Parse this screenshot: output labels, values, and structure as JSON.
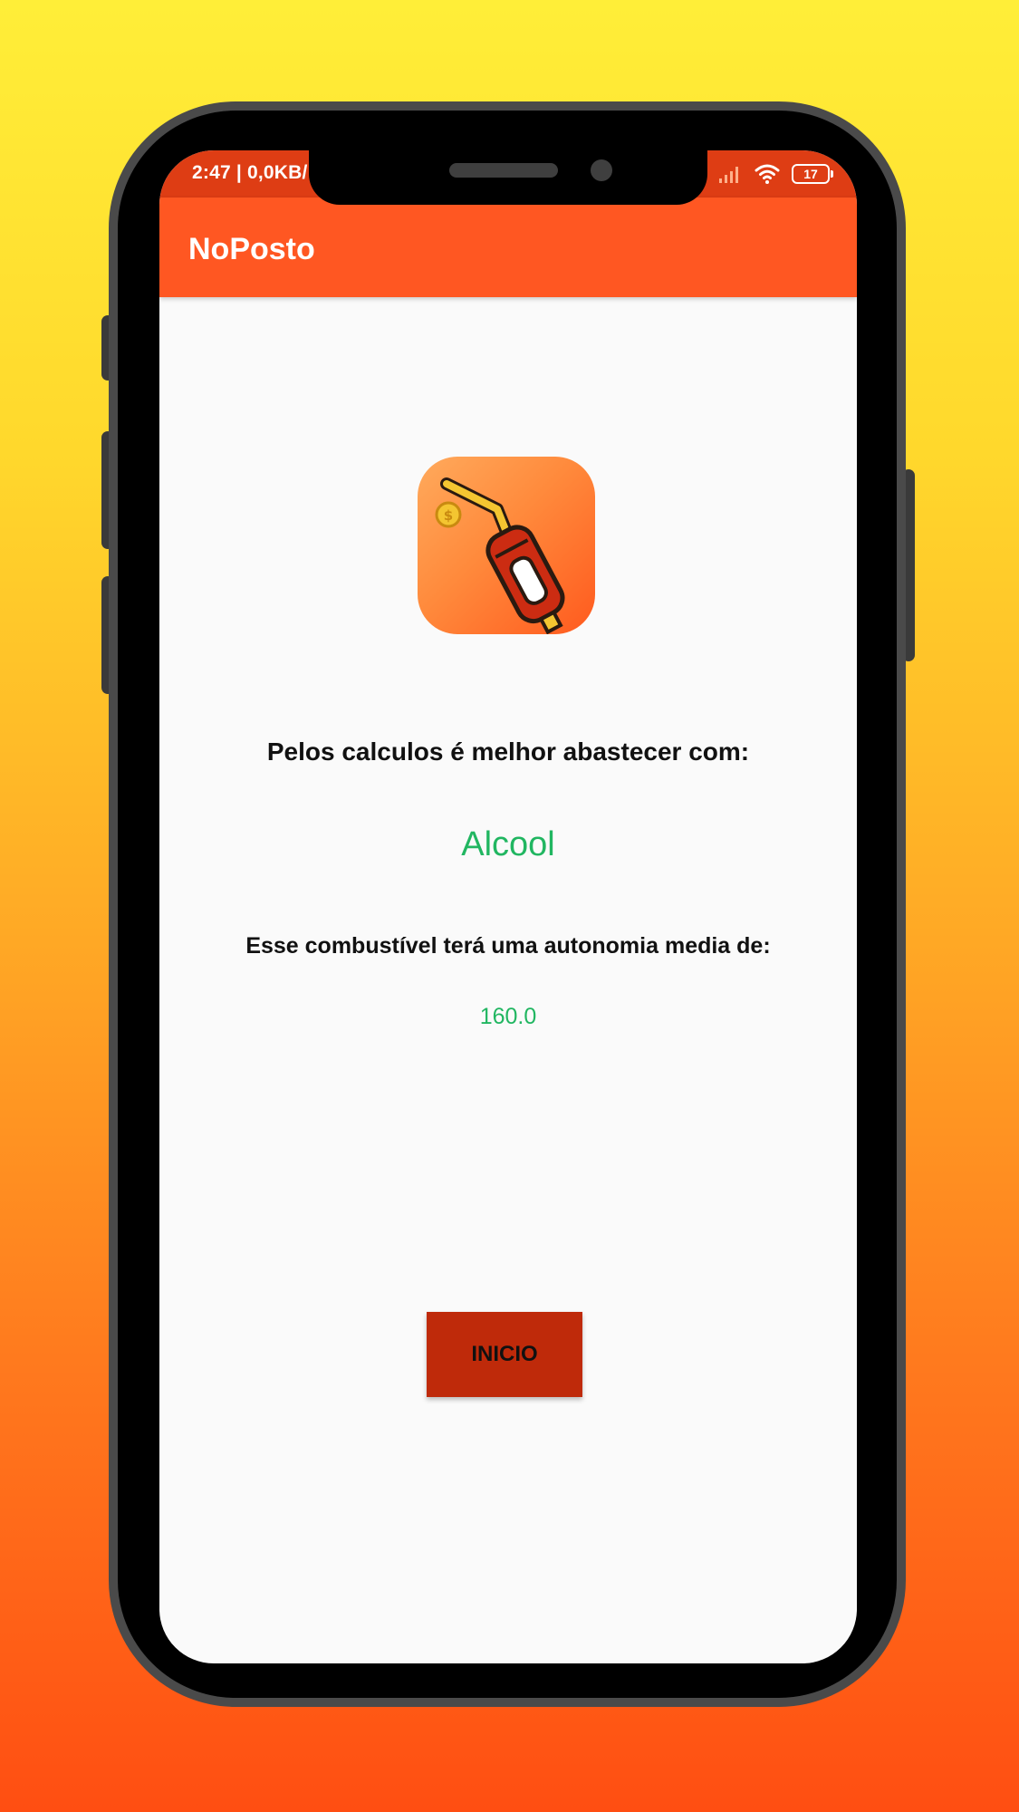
{
  "status_bar": {
    "time": "2:47 | 0,0KB/",
    "battery": "17",
    "icons": [
      "signal-icon",
      "wifi-icon",
      "battery-icon"
    ]
  },
  "app_bar": {
    "title": "NoPosto"
  },
  "logo": {
    "icon": "fuel-nozzle-icon"
  },
  "main": {
    "question": "Pelos calculos é melhor abastecer com:",
    "result": "Alcool",
    "autonomy_label": "Esse combustível terá uma autonomia media de:",
    "autonomy_value": "160.0"
  },
  "button": {
    "label": "INICIO"
  },
  "colors": {
    "background_top": "#FFEE38",
    "background_bottom": "#FF4E12",
    "app_bar": "#FF5722",
    "status_bar": "#DE3D14",
    "result_text": "#21B661",
    "button": "#BF2A0A"
  }
}
